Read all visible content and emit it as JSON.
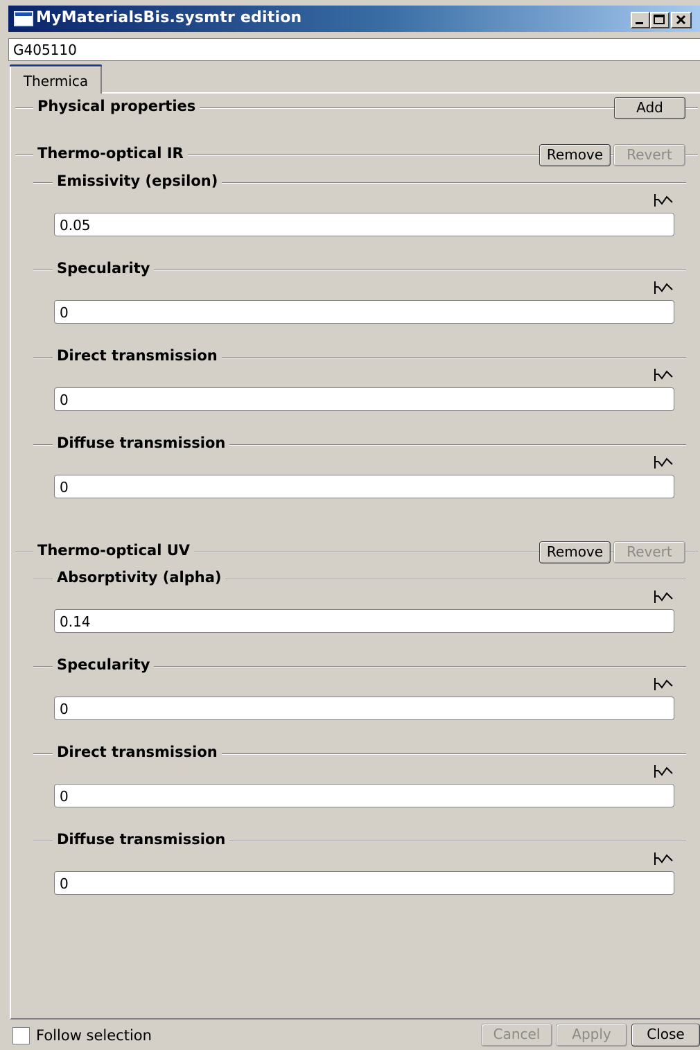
{
  "window": {
    "title": "MyMaterialsBis.sysmtr edition"
  },
  "name_value": "G405110",
  "tabs": [
    "Thermica"
  ],
  "physical_properties": {
    "title": "Physical properties",
    "add_label": "Add"
  },
  "ir": {
    "title": "Thermo-optical IR",
    "remove_label": "Remove",
    "revert_label": "Revert",
    "fields": [
      {
        "label": "Emissivity (epsilon)",
        "value": "0.05"
      },
      {
        "label": "Specularity",
        "value": "0"
      },
      {
        "label": "Direct transmission",
        "value": "0"
      },
      {
        "label": "Diffuse transmission",
        "value": "0"
      }
    ]
  },
  "uv": {
    "title": "Thermo-optical UV",
    "remove_label": "Remove",
    "revert_label": "Revert",
    "fields": [
      {
        "label": "Absorptivity (alpha)",
        "value": "0.14"
      },
      {
        "label": "Specularity",
        "value": "0"
      },
      {
        "label": "Direct transmission",
        "value": "0"
      },
      {
        "label": "Diffuse transmission",
        "value": "0"
      }
    ]
  },
  "footer": {
    "follow_selection_label": "Follow selection",
    "follow_selection_checked": false,
    "cancel_label": "Cancel",
    "apply_label": "Apply",
    "close_label": "Close"
  },
  "icons": {
    "curve": "curve-icon",
    "minimize": "minimize-icon",
    "maximize": "maximize-icon",
    "close": "close-icon"
  }
}
